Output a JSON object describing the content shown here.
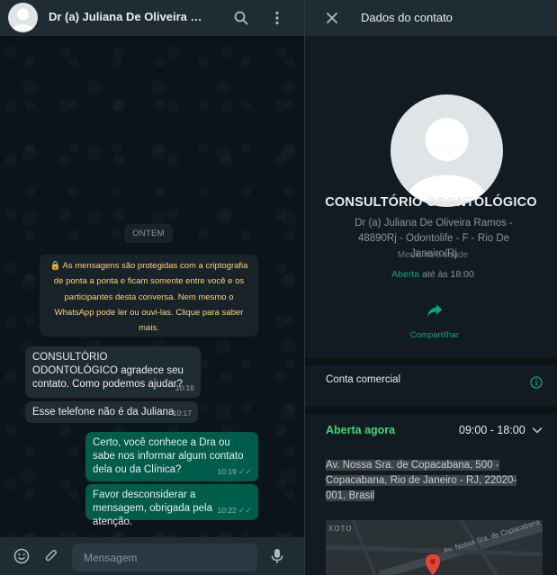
{
  "chat": {
    "title": "Dr (a) Juliana De Oliveira Ramos - 48890Rj - Odontolife - F - Rio De Janeiro/Rj",
    "day_label": "ONTEM",
    "encryption_notice": "🔒 As mensagens são protegidas com a criptografia de ponta a ponta e ficam somente entre você e os participantes desta conversa. Nem mesmo o WhatsApp pode ler ou ouvi-las. Clique para saber mais.",
    "messages": [
      {
        "direction": "in",
        "text": "CONSULTÓRIO ODONTOLÓGICO agradece seu contato. Como podemos ajudar?",
        "time": "10:16"
      },
      {
        "direction": "in",
        "text": "Esse telefone não é da Juliana",
        "time": "10:17"
      },
      {
        "direction": "out",
        "text": "Certo, você conhece a Dra ou sabe nos informar algum contato dela ou da Clínica?",
        "time": "10:19"
      },
      {
        "direction": "out",
        "text": "Favor desconsiderar a mensagem, obrigada pela atenção.",
        "time": "10:22"
      }
    ],
    "composer_placeholder": "Mensagem",
    "colors": {
      "incoming": "#202c33",
      "outgoing": "#005c4b",
      "notice_text": "#ffd279"
    }
  },
  "contact": {
    "panel_title": "Dados do contato",
    "name": "CONSULTÓRIO ODONTOLÓGICO",
    "subtitle": "Dr (a) Juliana De Oliveira Ramos - 48890Rj - Odontolife - F - Rio De Janeiro/Rj",
    "category": "Medicina e saúde",
    "status_open": "Aberta",
    "status_until": "até às 18:00",
    "share_label": "Compartilhar",
    "business_account_label": "Conta comercial",
    "hours_status": "Aberta agora",
    "hours_range": "09:00 - 18:00",
    "address": "Av. Nossa Sra. de Copacabana, 500 - Copacabana, Rio de Janeiro - RJ, 22020-001, Brasil",
    "map_street_label": "Av. Nossa Sra. de Copacabana",
    "map_area_label": "XOTO",
    "colors": {
      "accent": "#00a884",
      "open_now": "#42d46e"
    }
  },
  "icons": [
    "avatar-placeholder",
    "search-icon",
    "menu-dots-icon",
    "close-icon",
    "share-icon",
    "info-icon",
    "chevron-down-icon",
    "emoji-icon",
    "attach-icon",
    "mic-icon",
    "map-pin-icon"
  ]
}
